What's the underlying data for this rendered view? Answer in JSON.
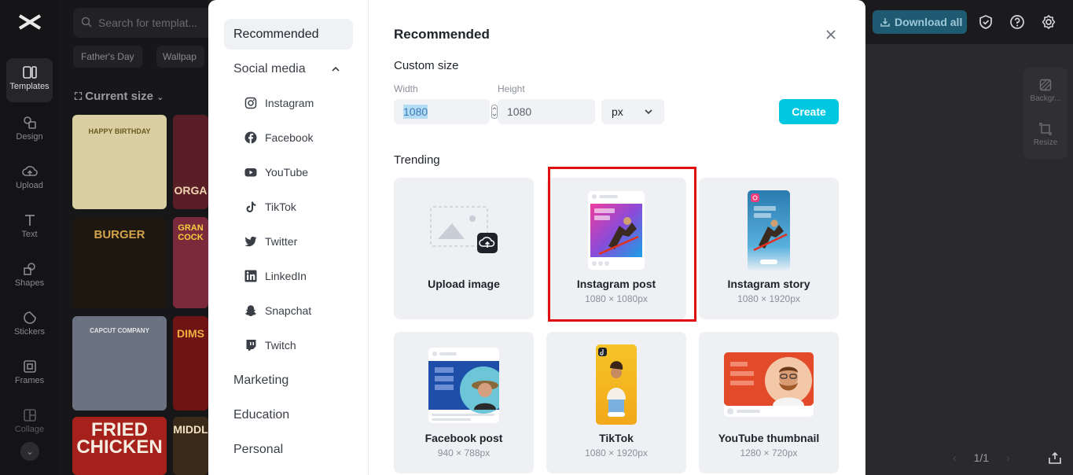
{
  "app": {
    "rail": [
      {
        "label": "Templates",
        "icon": "templates-icon"
      },
      {
        "label": "Design",
        "icon": "design-icon"
      },
      {
        "label": "Upload",
        "icon": "upload-icon"
      },
      {
        "label": "Text",
        "icon": "text-icon"
      },
      {
        "label": "Shapes",
        "icon": "shapes-icon"
      },
      {
        "label": "Stickers",
        "icon": "stickers-icon"
      },
      {
        "label": "Frames",
        "icon": "frames-icon"
      },
      {
        "label": "Collage",
        "icon": "collage-icon"
      }
    ],
    "search_placeholder": "Search for templat...",
    "chips": [
      "Father's Day",
      "Wallpap"
    ],
    "current_size": "Current size",
    "tiles": [
      "HAPPY BIRTHDAY",
      "BURGER",
      "CAPCUT COMPANY",
      "FRIED CHICKEN",
      "GRAN COCK",
      "DIMS",
      "ORGA",
      "MIDDL"
    ],
    "download_all": "Download all",
    "side_tools": [
      "Backgr...",
      "Resize"
    ],
    "pager": "1/1"
  },
  "modal": {
    "nav": {
      "main": [
        {
          "label": "Recommended",
          "active": true
        },
        {
          "label": "Social media",
          "expanded": true
        },
        {
          "label": "Marketing"
        },
        {
          "label": "Education"
        },
        {
          "label": "Personal"
        }
      ],
      "social": [
        {
          "label": "Instagram",
          "icon": "instagram-icon"
        },
        {
          "label": "Facebook",
          "icon": "facebook-icon"
        },
        {
          "label": "YouTube",
          "icon": "youtube-icon"
        },
        {
          "label": "TikTok",
          "icon": "tiktok-icon"
        },
        {
          "label": "Twitter",
          "icon": "twitter-icon"
        },
        {
          "label": "LinkedIn",
          "icon": "linkedin-icon"
        },
        {
          "label": "Snapchat",
          "icon": "snapchat-icon"
        },
        {
          "label": "Twitch",
          "icon": "twitch-icon"
        }
      ]
    },
    "title": "Recommended",
    "custom_size": {
      "title": "Custom size",
      "width_label": "Width",
      "height_label": "Height",
      "width_value": "1080",
      "height_value": "1080",
      "unit": "px",
      "create_label": "Create"
    },
    "trending": {
      "title": "Trending",
      "cards": [
        {
          "title": "Upload image",
          "size": ""
        },
        {
          "title": "Instagram post",
          "size": "1080 × 1080px"
        },
        {
          "title": "Instagram story",
          "size": "1080 × 1920px"
        },
        {
          "title": "Facebook post",
          "size": "940 × 788px"
        },
        {
          "title": "TikTok",
          "size": "1080 × 1920px"
        },
        {
          "title": "YouTube thumbnail",
          "size": "1280 × 720px"
        }
      ]
    }
  }
}
